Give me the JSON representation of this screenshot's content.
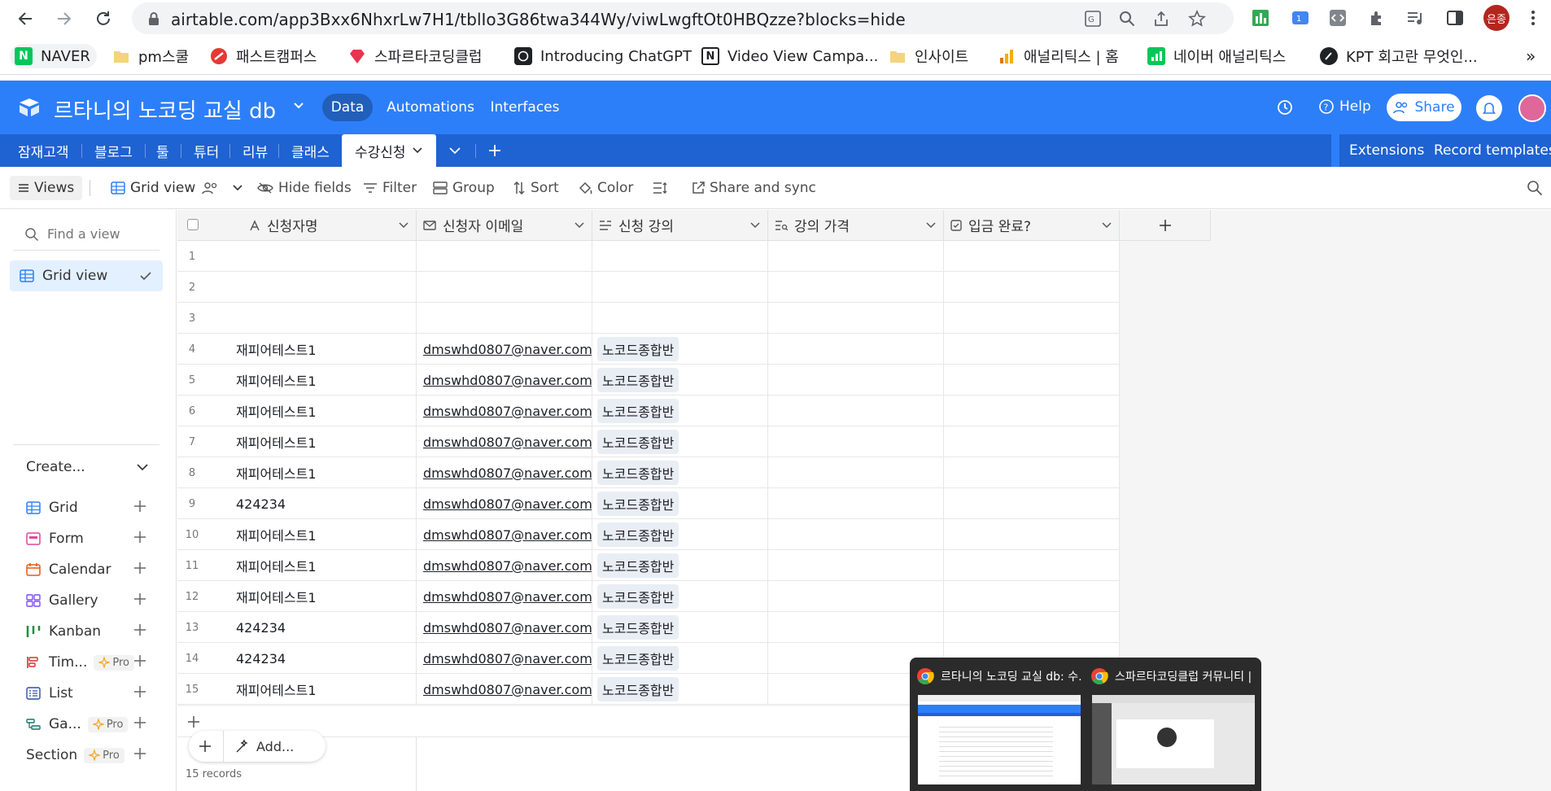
{
  "browser": {
    "url": "airtable.com/app3Bxx6NhxrLw7H1/tblIo3G86twa344Wy/viwLwgftOt0HBQzze?blocks=hide",
    "profile_initials": "은종",
    "bookmarks": [
      "NAVER",
      "pm스쿨",
      "패스트캠퍼스",
      "스파르타코딩클럽",
      "Introducing ChatGPT",
      "Video View Campa...",
      "인사이트",
      "애널리틱스 | 홈",
      "네이버 애널리틱스",
      "KPT 회고란 무엇인..."
    ],
    "more": "»"
  },
  "header": {
    "base_name": "르타니의 노코딩 교실 db",
    "tabs": [
      "Data",
      "Automations",
      "Interfaces"
    ],
    "help": "Help",
    "share": "Share"
  },
  "tables": {
    "items": [
      "잠재고객",
      "블로그",
      "툴",
      "튜터",
      "리뷰",
      "클래스",
      "수강신청"
    ],
    "right": [
      "Extensions",
      "Record templates"
    ]
  },
  "toolbar": {
    "views": "Views",
    "grid_view": "Grid view",
    "hide_fields": "Hide fields",
    "filter": "Filter",
    "group": "Group",
    "sort": "Sort",
    "color": "Color",
    "share_sync": "Share and sync"
  },
  "sidebar": {
    "find_placeholder": "Find a view",
    "active_view": "Grid view",
    "create": "Create...",
    "create_items": [
      "Grid",
      "Form",
      "Calendar",
      "Gallery",
      "Kanban",
      "Tim...",
      "List",
      "Ga...",
      "Section"
    ],
    "pro": "Pro"
  },
  "grid": {
    "columns": [
      "신청자명",
      "신청자 이메일",
      "신청 강의",
      "강의 가격",
      "입금 완료?"
    ],
    "rows": [
      {
        "n": "1",
        "name": "",
        "email": "",
        "course": ""
      },
      {
        "n": "2",
        "name": "",
        "email": "",
        "course": ""
      },
      {
        "n": "3",
        "name": "",
        "email": "",
        "course": ""
      },
      {
        "n": "4",
        "name": "재피어테스트1",
        "email": "dmswhd0807@naver.com",
        "course": "노코드종합반"
      },
      {
        "n": "5",
        "name": "재피어테스트1",
        "email": "dmswhd0807@naver.com",
        "course": "노코드종합반"
      },
      {
        "n": "6",
        "name": "재피어테스트1",
        "email": "dmswhd0807@naver.com",
        "course": "노코드종합반"
      },
      {
        "n": "7",
        "name": "재피어테스트1",
        "email": "dmswhd0807@naver.com",
        "course": "노코드종합반"
      },
      {
        "n": "8",
        "name": "재피어테스트1",
        "email": "dmswhd0807@naver.com",
        "course": "노코드종합반"
      },
      {
        "n": "9",
        "name": "424234",
        "email": "dmswhd0807@naver.com",
        "course": "노코드종합반"
      },
      {
        "n": "10",
        "name": "재피어테스트1",
        "email": "dmswhd0807@naver.com",
        "course": "노코드종합반"
      },
      {
        "n": "11",
        "name": "재피어테스트1",
        "email": "dmswhd0807@naver.com",
        "course": "노코드종합반"
      },
      {
        "n": "12",
        "name": "재피어테스트1",
        "email": "dmswhd0807@naver.com",
        "course": "노코드종합반"
      },
      {
        "n": "13",
        "name": "424234",
        "email": "dmswhd0807@naver.com",
        "course": "노코드종합반"
      },
      {
        "n": "14",
        "name": "424234",
        "email": "dmswhd0807@naver.com",
        "course": "노코드종합반"
      },
      {
        "n": "15",
        "name": "재피어테스트1",
        "email": "dmswhd0807@naver.com",
        "course": "노코드종합반"
      }
    ],
    "add_label": "Add...",
    "record_count": "15 records"
  },
  "taskbar_preview": {
    "windows": [
      "르타니의 노코딩 교실 db: 수...",
      "스파르타코딩클럽 커뮤니티 | ..."
    ]
  },
  "colors": {
    "brand_blue": "#2d7ff9",
    "tab_strip": "#1f62d1"
  }
}
